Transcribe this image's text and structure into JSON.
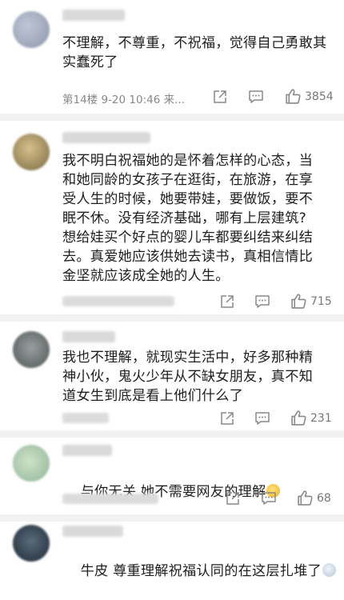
{
  "comments": [
    {
      "text": "不理解，不尊重，不祝福，觉得自己勇敢其\n实蠢死了",
      "meta": "第14楼 9-20 10:46 来...",
      "likes": "3854"
    },
    {
      "text": "我不明白祝福她的是怀着怎样的心态，当\n和她同龄的女孩子在逛街，在旅游，在享\n受人生的时候，她要带娃，要做饭，要不\n眠不休。没有经济基础，哪有上层建筑?\n想给娃买个好点的婴儿车都要纠结来纠结\n去。真爱她应该供她去读书，真相信情比\n金坚就应该成全她的人生。",
      "likes": "715"
    },
    {
      "text": "我也不理解，就现实生活中，好多那种精\n神小伙，鬼火少年从不缺女朋友，真不知\n道女生到底是看上他们什么了",
      "likes": "231"
    },
    {
      "text": "与你无关 她不需要网友的理解",
      "emoji": "grinning-sweat-emoji",
      "likes": "68"
    },
    {
      "text": "牛皮 尊重理解祝福认同的在这层扎堆了",
      "emoji": "worried-face-emoji"
    }
  ],
  "icons": [
    "share-icon",
    "comment-icon",
    "like-icon"
  ],
  "colors": {
    "divider": "#f2f2f2",
    "meta": "#888888",
    "text": "#1f1f1f"
  }
}
